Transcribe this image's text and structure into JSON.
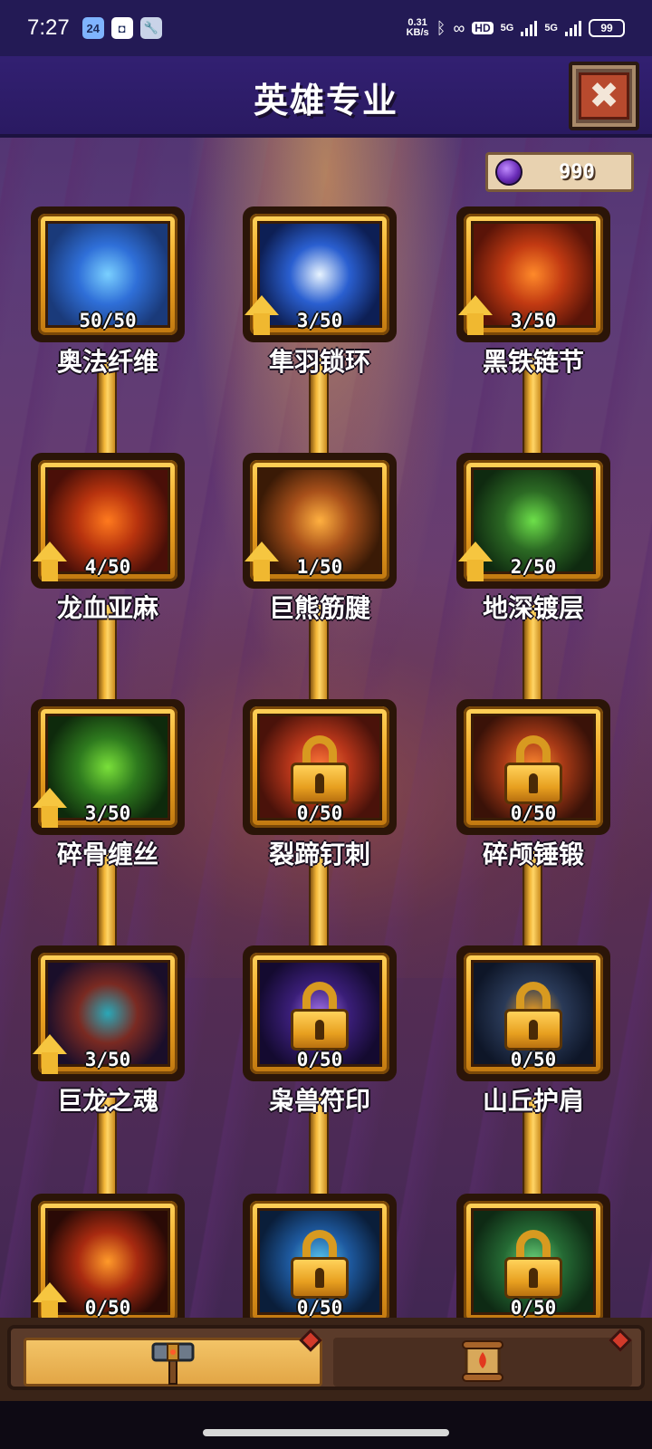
{
  "status_bar": {
    "time": "7:27",
    "net_speed_value": "0.31",
    "net_speed_unit": "KB/s",
    "hd_label": "HD",
    "network_1": "5G",
    "network_2": "5G",
    "battery": "99",
    "app_icons": [
      "calendar-icon",
      "app-icon",
      "wrench-icon"
    ]
  },
  "header": {
    "title": "英雄专业",
    "close_symbol": "✖"
  },
  "currency": {
    "icon": "purple-gem-icon",
    "value": "990"
  },
  "skills": [
    {
      "name": "奥法纤维",
      "level": "50/50",
      "locked": false,
      "upgradable": false,
      "icon": "arcane-fiber-icon",
      "colors": [
        "#1a3a7a",
        "#2f6fd8",
        "#7ad0ff"
      ]
    },
    {
      "name": "隼羽锁环",
      "level": "3/50",
      "locked": false,
      "upgradable": true,
      "icon": "feather-icon",
      "colors": [
        "#0d1f55",
        "#2a5fd0",
        "#e8f4ff"
      ]
    },
    {
      "name": "黑铁链节",
      "level": "3/50",
      "locked": false,
      "upgradable": true,
      "icon": "chain-icon",
      "colors": [
        "#5a1408",
        "#c23a12",
        "#ff8a2a"
      ]
    },
    {
      "name": "龙血亚麻",
      "level": "4/50",
      "locked": false,
      "upgradable": true,
      "icon": "dragon-icon",
      "colors": [
        "#4a0f08",
        "#b8330e",
        "#ff7a1e"
      ]
    },
    {
      "name": "巨熊筋腱",
      "level": "1/50",
      "locked": false,
      "upgradable": true,
      "icon": "paw-icon",
      "colors": [
        "#3a1a06",
        "#a8501a",
        "#ffb040"
      ]
    },
    {
      "name": "地深镀层",
      "level": "2/50",
      "locked": false,
      "upgradable": true,
      "icon": "earth-plate-icon",
      "colors": [
        "#0f2a10",
        "#2c6a24",
        "#6de04a"
      ]
    },
    {
      "name": "碎骨缠丝",
      "level": "3/50",
      "locked": false,
      "upgradable": true,
      "icon": "skull-icon",
      "colors": [
        "#0e2a0c",
        "#2e7a1e",
        "#7ae03a"
      ]
    },
    {
      "name": "裂蹄钉刺",
      "level": "0/50",
      "locked": true,
      "upgradable": false,
      "icon": "spike-icon",
      "colors": [
        "#4a120a",
        "#b8361a",
        "#ff7a3a"
      ]
    },
    {
      "name": "碎颅锤锻",
      "level": "0/50",
      "locked": true,
      "upgradable": false,
      "icon": "hammer-icon",
      "colors": [
        "#3a1208",
        "#a83a16",
        "#ff8a30"
      ]
    },
    {
      "name": "巨龙之魂",
      "level": "3/50",
      "locked": false,
      "upgradable": true,
      "icon": "dragon-soul-icon",
      "colors": [
        "#1a0e2a",
        "#7a2a22",
        "#2aa8b8"
      ]
    },
    {
      "name": "枭兽符印",
      "level": "0/50",
      "locked": true,
      "upgradable": false,
      "icon": "moon-rune-icon",
      "colors": [
        "#140a30",
        "#3a1e78",
        "#a070e8"
      ]
    },
    {
      "name": "山丘护肩",
      "level": "0/50",
      "locked": true,
      "upgradable": false,
      "icon": "pauldron-icon",
      "colors": [
        "#0e1628",
        "#2a3a58",
        "#f0a020"
      ]
    },
    {
      "name": "",
      "level": "0/50",
      "locked": false,
      "upgradable": true,
      "icon": "anvil-icon",
      "colors": [
        "#2a0a06",
        "#a82a10",
        "#ff9a2a"
      ]
    },
    {
      "name": "",
      "level": "0/50",
      "locked": true,
      "upgradable": false,
      "icon": "water-icon",
      "colors": [
        "#0a1e3a",
        "#1e5aa0",
        "#5ac8f0"
      ]
    },
    {
      "name": "",
      "level": "0/50",
      "locked": true,
      "upgradable": false,
      "icon": "stone-icon",
      "colors": [
        "#0e2a14",
        "#256a34",
        "#6ad07a"
      ]
    }
  ],
  "tabs": [
    {
      "icon": "hammer-tab-icon",
      "active": true
    },
    {
      "icon": "scroll-tab-icon",
      "active": false
    }
  ]
}
